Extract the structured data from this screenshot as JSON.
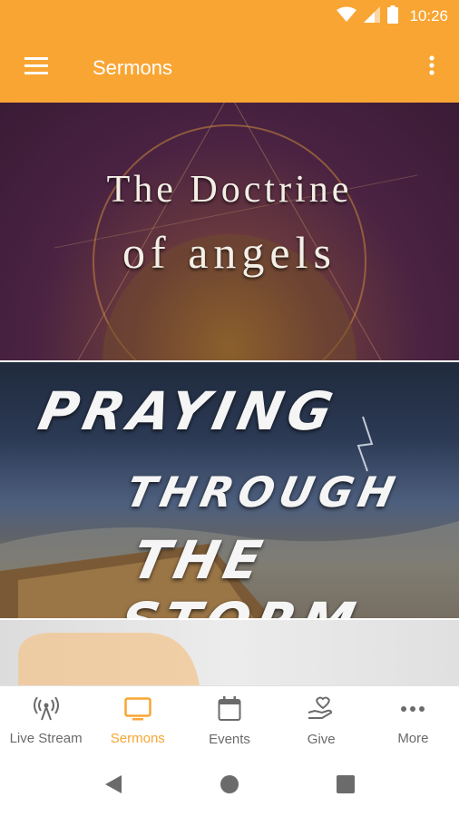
{
  "status_bar": {
    "time": "10:26",
    "icons": [
      "wifi-icon",
      "signal-icon",
      "battery-icon"
    ]
  },
  "app_bar": {
    "title": "Sermons",
    "menu_icon": "menu-icon",
    "overflow_icon": "more-vert-icon"
  },
  "sermons": [
    {
      "title_line1": "The Doctrine",
      "title_line2": "of angels"
    },
    {
      "title_line1": "PRAYING",
      "title_line2": "THROUGH",
      "title_line3": "THE STORM"
    }
  ],
  "bottom_nav": {
    "items": [
      {
        "label": "Live Stream",
        "icon": "broadcast-icon"
      },
      {
        "label": "Sermons",
        "icon": "tv-icon",
        "active": true
      },
      {
        "label": "Events",
        "icon": "calendar-icon"
      },
      {
        "label": "Give",
        "icon": "give-heart-hand-icon"
      },
      {
        "label": "More",
        "icon": "more-horiz-icon"
      }
    ]
  },
  "colors": {
    "primary": "#F9A533",
    "inactive": "#6a6a6a",
    "system_icon": "#6b6b6b"
  }
}
